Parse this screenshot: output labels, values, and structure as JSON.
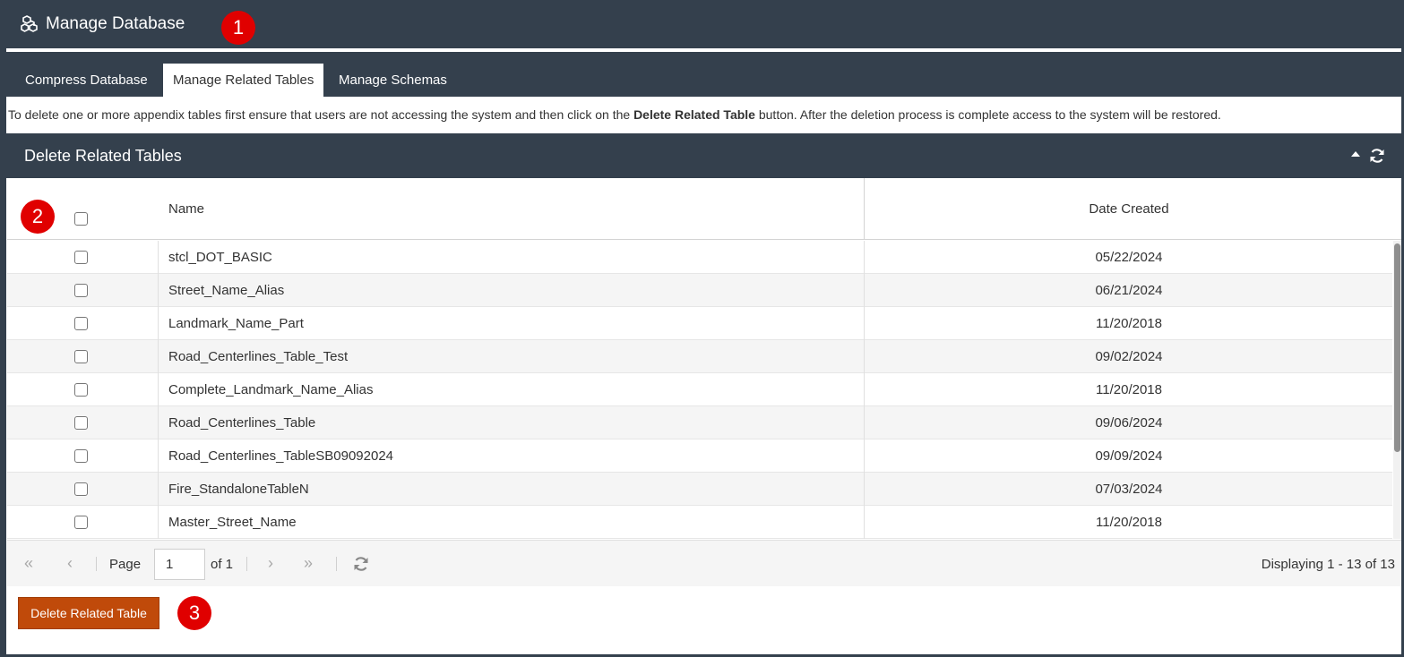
{
  "window": {
    "title": "Manage Database",
    "icon": "cubes-icon"
  },
  "annotations": [
    "1",
    "2",
    "3"
  ],
  "tabs": [
    {
      "label": "Compress Database",
      "active": false
    },
    {
      "label": "Manage Related Tables",
      "active": true
    },
    {
      "label": "Manage Schemas",
      "active": false
    }
  ],
  "instructions": {
    "pre": "To delete one or more appendix tables first ensure that users are not accessing the system and then click on the ",
    "bold": "Delete Related Table",
    "post": " button. After the deletion process is complete access to the system will be restored."
  },
  "panel": {
    "title": "Delete Related Tables"
  },
  "grid": {
    "columns": {
      "name": "Name",
      "date": "Date Created"
    },
    "rows": [
      {
        "name": "stcl_DOT_BASIC",
        "date": "05/22/2024"
      },
      {
        "name": "Street_Name_Alias",
        "date": "06/21/2024"
      },
      {
        "name": "Landmark_Name_Part",
        "date": "11/20/2018"
      },
      {
        "name": "Road_Centerlines_Table_Test",
        "date": "09/02/2024"
      },
      {
        "name": "Complete_Landmark_Name_Alias",
        "date": "11/20/2018"
      },
      {
        "name": "Road_Centerlines_Table",
        "date": "09/06/2024"
      },
      {
        "name": "Road_Centerlines_TableSB09092024",
        "date": "09/09/2024"
      },
      {
        "name": "Fire_StandaloneTableN",
        "date": "07/03/2024"
      },
      {
        "name": "Master_Street_Name",
        "date": "11/20/2018"
      }
    ]
  },
  "pager": {
    "page_label": "Page",
    "page_value": "1",
    "of_label": "of 1",
    "display_text": "Displaying 1 - 13 of 13"
  },
  "actions": {
    "delete_label": "Delete Related Table"
  },
  "colors": {
    "header_bg": "#34404d",
    "badge": "#e00000",
    "delete_button": "#c04a0a"
  }
}
